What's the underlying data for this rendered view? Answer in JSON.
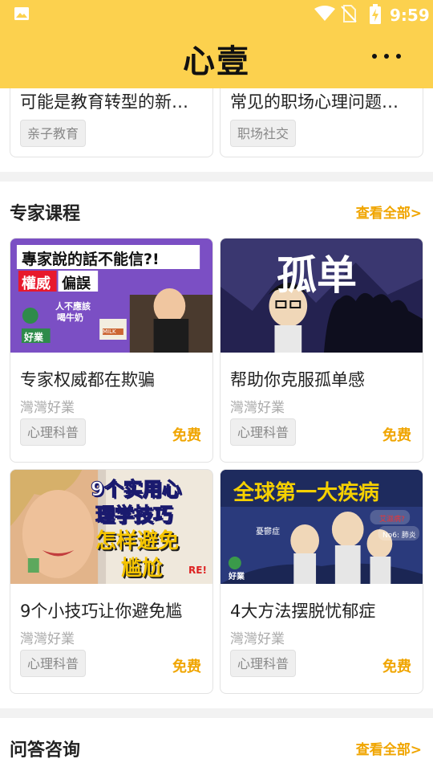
{
  "status": {
    "time": "9:59"
  },
  "header": {
    "title": "心壹"
  },
  "top_cards": [
    {
      "title": "可能是教育转型的新…",
      "tag": "亲子教育"
    },
    {
      "title": "常见的职场心理问题…",
      "tag": "职场社交"
    }
  ],
  "expert": {
    "title": "专家课程",
    "view_all": "查看全部>",
    "courses": [
      {
        "title": "专家权威都在欺骗",
        "author": "灣灣好業",
        "tag": "心理科普",
        "price": "免费",
        "thumb": {
          "headline": "專家說的話不能信?!",
          "red": "權威",
          "red2": "偏誤",
          "caption1": "人不應該",
          "caption2": "喝牛奶",
          "brand": "好業",
          "milk": "MILK"
        }
      },
      {
        "title": "帮助你克服孤单感",
        "author": "灣灣好業",
        "tag": "心理科普",
        "price": "免费",
        "thumb": {
          "headline": "孤单"
        }
      },
      {
        "title": "9个小技巧让你避免尴",
        "author": "灣灣好業",
        "tag": "心理科普",
        "price": "免费",
        "thumb": {
          "line1": "9个实用心",
          "line2": "理学技巧",
          "line3": "怎样避免",
          "line4": "尴尬",
          "corner": "RE!"
        }
      },
      {
        "title": "4大方法摆脱忧郁症",
        "author": "灣灣好業",
        "tag": "心理科普",
        "price": "免费",
        "thumb": {
          "headline": "全球第一大疾病",
          "bubble1": "艾滋病?",
          "bubble2": "No6: 肺炎",
          "bubble3": "憂鬱症",
          "brand": "好業"
        }
      }
    ]
  },
  "qa": {
    "title": "问答咨询",
    "view_all": "查看全部>"
  },
  "colors": {
    "brand_yellow": "#fcd14e",
    "accent_orange": "#f0a500"
  }
}
